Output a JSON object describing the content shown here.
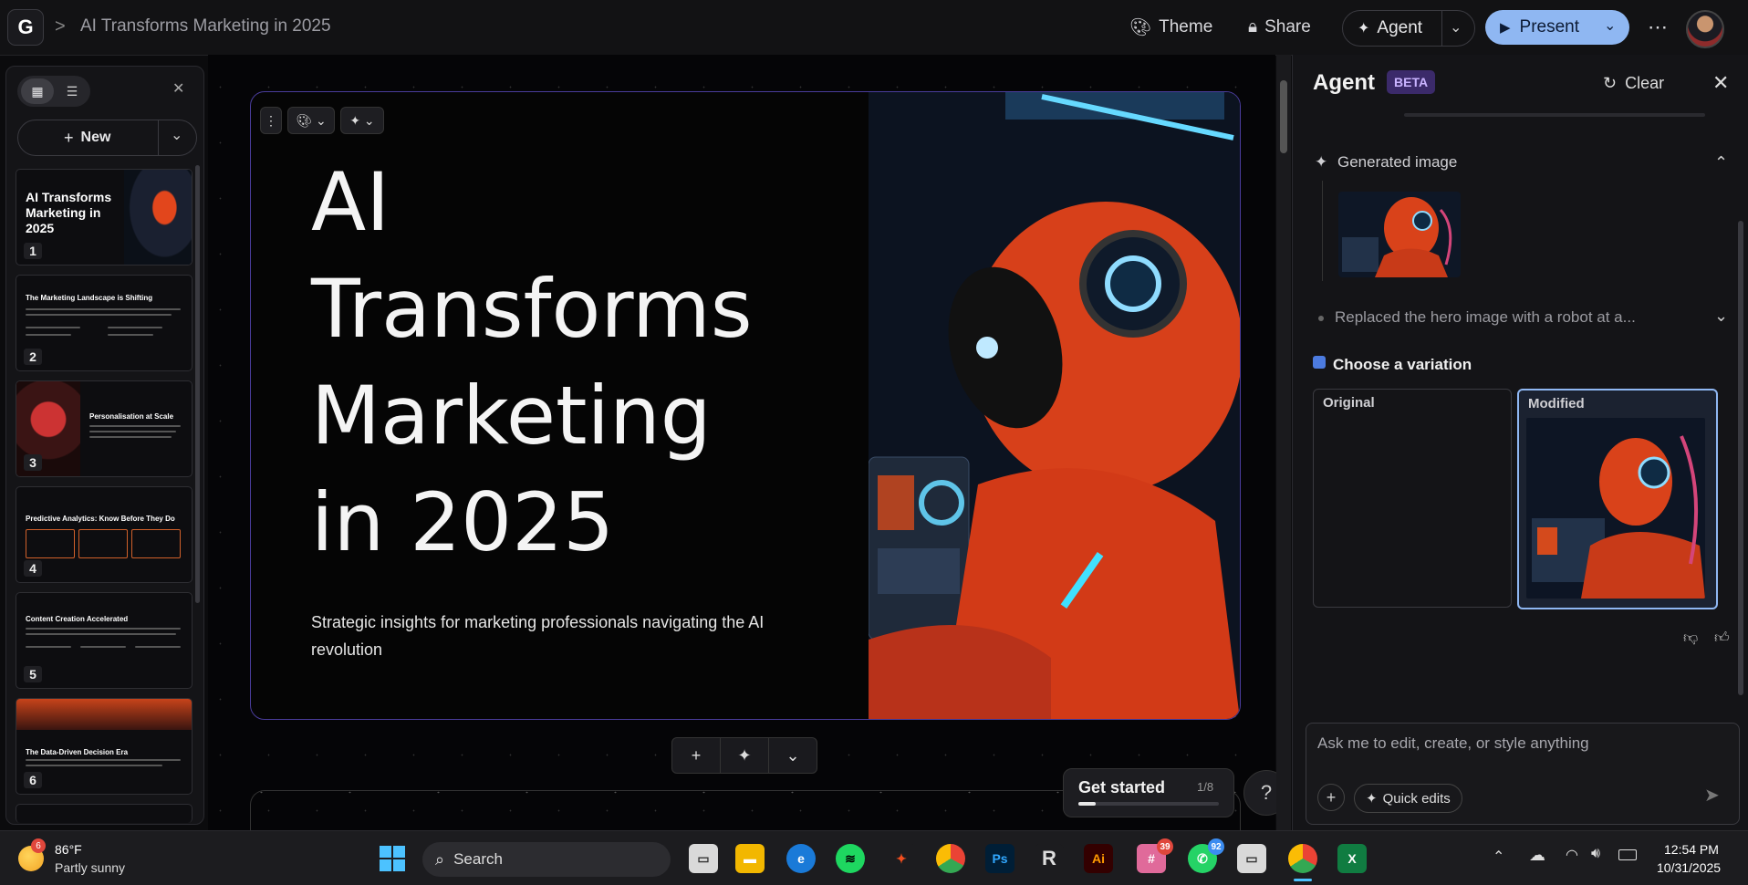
{
  "header": {
    "breadcrumb_sep": ">",
    "doc_title": "AI Transforms Marketing in 2025",
    "theme_label": "Theme",
    "share_label": "Share",
    "agent_label": "Agent",
    "present_label": "Present",
    "more_label": "⋯"
  },
  "left_panel": {
    "new_label": "New",
    "slides": [
      {
        "num": "1",
        "title": "AI Transforms Marketing in 2025"
      },
      {
        "num": "2",
        "title": "The Marketing Landscape is Shifting"
      },
      {
        "num": "3",
        "title": "Personalisation at Scale"
      },
      {
        "num": "4",
        "title": "Predictive Analytics: Know Before They Do"
      },
      {
        "num": "5",
        "title": "Content Creation Accelerated"
      },
      {
        "num": "6",
        "title": "The Data-Driven Decision Era"
      }
    ]
  },
  "slide": {
    "title": "AI Transforms Marketing in 2025",
    "subtitle": "Strategic insights for marketing professionals navigating the AI revolution"
  },
  "get_started": {
    "label": "Get started",
    "progress": "1/8",
    "progress_fraction": 0.125
  },
  "help_label": "?",
  "agent": {
    "title": "Agent",
    "badge": "BETA",
    "clear_label": "Clear",
    "generated_image_label": "Generated image",
    "replaced_text": "Replaced the hero image with a robot at a...",
    "choose_label": "Choose a variation",
    "variation_original": "Original",
    "variation_modified": "Modified",
    "input_placeholder": "Ask me to edit, create, or style anything",
    "quick_edits_label": "Quick edits"
  },
  "taskbar": {
    "weather_temp": "86°F",
    "weather_desc": "Partly sunny",
    "weather_badge": "6",
    "search_label": "Search",
    "time": "12:54 PM",
    "date": "10/31/2025",
    "slack_badge": "39",
    "whatsapp_badge": "92"
  },
  "colors": {
    "accent": "#8fb7f2",
    "slide_border": "#4a3d9c",
    "beta_bg": "#3b2a6a",
    "robot_orange": "#e2461c"
  }
}
